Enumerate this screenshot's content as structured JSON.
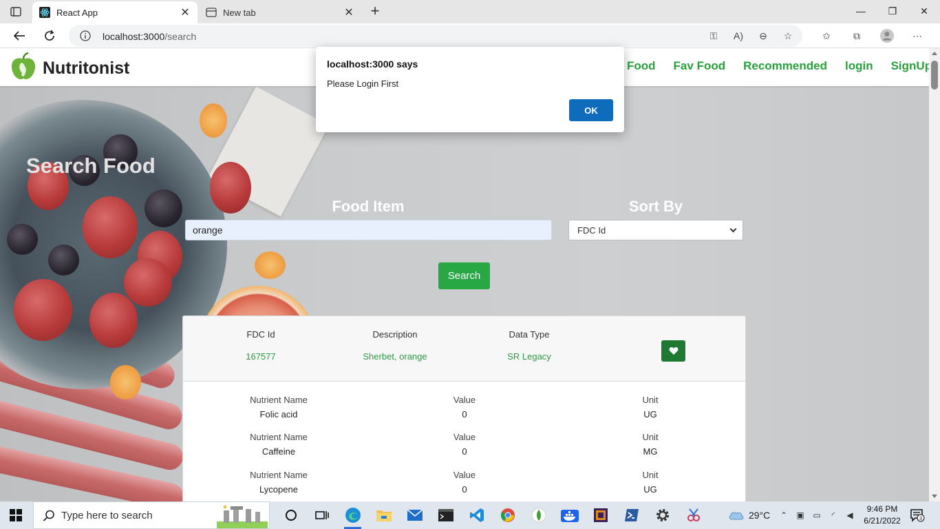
{
  "browser": {
    "tabs": [
      {
        "title": "React App",
        "active": true,
        "icon": "react-icon"
      },
      {
        "title": "New tab",
        "active": false,
        "icon": "new-tab-page-icon"
      }
    ],
    "url_host": "localhost:3000",
    "url_path": "/search"
  },
  "nav": {
    "brand": "Nutritonist",
    "links": [
      "Food",
      "Fav Food",
      "Recommended",
      "login",
      "SignUp"
    ]
  },
  "page": {
    "title": "Search Food",
    "food_label": "Food Item",
    "sort_label": "Sort By",
    "food_value": "orange",
    "sort_value": "FDC Id",
    "search_label": "Search"
  },
  "result": {
    "headers": [
      "FDC Id",
      "Description",
      "Data Type"
    ],
    "values": [
      "167577",
      "Sherbet, orange",
      "SR Legacy"
    ],
    "nutrient_headers": [
      "Nutrient Name",
      "Value",
      "Unit"
    ],
    "nutrients": [
      {
        "name": "Folic acid",
        "value": "0",
        "unit": "UG"
      },
      {
        "name": "Caffeine",
        "value": "0",
        "unit": "MG"
      },
      {
        "name": "Lycopene",
        "value": "0",
        "unit": "UG"
      }
    ]
  },
  "dialog": {
    "origin": "localhost:3000 says",
    "message": "Please Login First",
    "ok_label": "OK"
  },
  "taskbar": {
    "search_placeholder": "Type here to search",
    "temperature": "29°C",
    "time": "9:46 PM",
    "date": "6/21/2022",
    "notification_count": "3"
  },
  "colors": {
    "accent_green": "#28a745",
    "link_green": "#28a03c",
    "dialog_button": "#0f6cbd"
  }
}
